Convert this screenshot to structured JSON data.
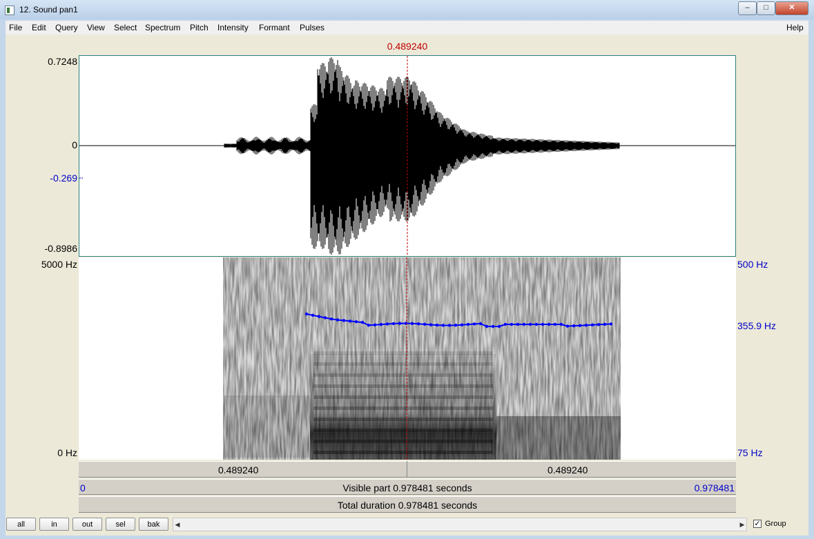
{
  "window": {
    "title": "12. Sound pan1",
    "min_glyph": "–",
    "max_glyph": "□",
    "close_glyph": "✕"
  },
  "menu": [
    "File",
    "Edit",
    "Query",
    "View",
    "Select",
    "Spectrum",
    "Pitch",
    "Intensity",
    "Formant",
    "Pulses"
  ],
  "help_label": "Help",
  "cursor_time": "0.489240",
  "waveform": {
    "max_label": "0.7248",
    "zero_label": "0",
    "cursor_value_label": "-0.269",
    "min_label": "-0.8986"
  },
  "spectrogram": {
    "top_freq_label": "5000 Hz",
    "bottom_freq_label": "0 Hz",
    "pitch_top_label": "500 Hz",
    "pitch_cursor_label": "355.9 Hz",
    "pitch_bottom_label": "75 Hz",
    "pitch_color": "#0000ff"
  },
  "selection_bar": {
    "left_time": "0.489240",
    "right_time": "0.489240"
  },
  "visible_bar": {
    "start": "0",
    "text": "Visible part 0.978481 seconds",
    "end": "0.978481"
  },
  "total_bar": {
    "text": "Total duration 0.978481 seconds"
  },
  "buttons": {
    "all": "all",
    "in": "in",
    "out": "out",
    "sel": "sel",
    "bak": "bak"
  },
  "scroll": {
    "left_arrow": "◀",
    "right_arrow": "▶"
  },
  "group": {
    "label": "Group",
    "checked": true,
    "check_glyph": "✓"
  },
  "colors": {
    "cursor": "#c00000",
    "axis_blue": "#0000c8"
  }
}
